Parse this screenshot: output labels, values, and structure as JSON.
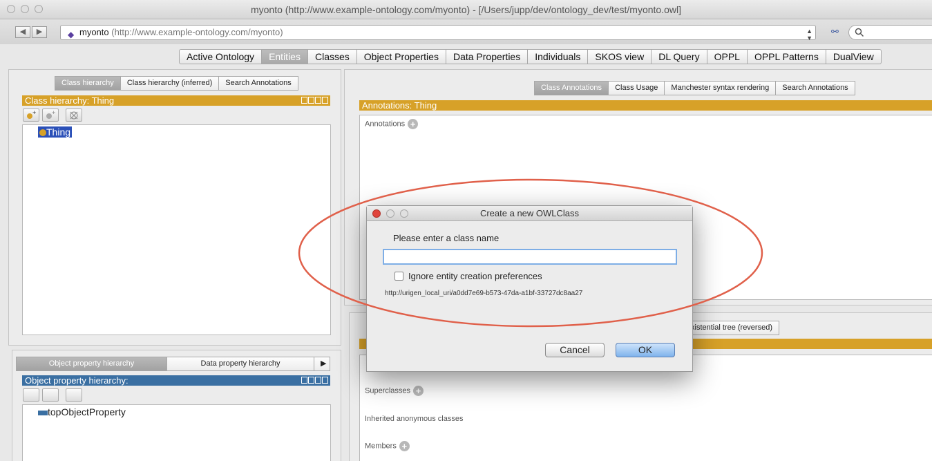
{
  "window": {
    "title": "myonto (http://www.example-ontology.com/myonto) - [/Users/jupp/dev/ontology_dev/test/myonto.owl]"
  },
  "toolbar": {
    "ontology_name": "myonto",
    "ontology_url": "(http://www.example-ontology.com/myonto)",
    "search_placeholder": ""
  },
  "main_tabs": [
    {
      "label": "Active Ontology"
    },
    {
      "label": "Entities",
      "active": true
    },
    {
      "label": "Classes"
    },
    {
      "label": "Object Properties"
    },
    {
      "label": "Data Properties"
    },
    {
      "label": "Individuals"
    },
    {
      "label": "SKOS view"
    },
    {
      "label": "DL Query"
    },
    {
      "label": "OPPL"
    },
    {
      "label": "OPPL Patterns"
    },
    {
      "label": "DualView"
    }
  ],
  "left_top": {
    "tabs": [
      "Class hierarchy",
      "Class hierarchy (inferred)",
      "Search Annotations"
    ],
    "header": "Class hierarchy: Thing",
    "tree_item": "Thing"
  },
  "left_bottom": {
    "tabs": [
      "Object property hierarchy",
      "Data property hierarchy"
    ],
    "header": "Object property hierarchy:",
    "tree_item": "topObjectProperty"
  },
  "right_top": {
    "tabs": [
      "Class Annotations",
      "Class Usage",
      "Manchester syntax rendering",
      "Search Annotations"
    ],
    "header": "Annotations: Thing",
    "annotations_label": "Annotations"
  },
  "right_bottom": {
    "tab_partial": "xistential tree (reversed)",
    "superclasses_label": "Superclasses",
    "inherited_label": "Inherited anonymous classes",
    "members_label": "Members"
  },
  "dialog": {
    "title": "Create a new OWLClass",
    "prompt": "Please enter a class name",
    "input_value": "",
    "checkbox_label": "Ignore entity creation preferences",
    "checkbox_checked": false,
    "uri": "http://urigen_local_uri/a0dd7e69-b573-47da-a1bf-33727dc8aa27",
    "cancel_label": "Cancel",
    "ok_label": "OK"
  },
  "colors": {
    "gold_header": "#d7a128",
    "blue_header": "#3a6fa2",
    "highlight_ellipse": "#e0604a"
  }
}
